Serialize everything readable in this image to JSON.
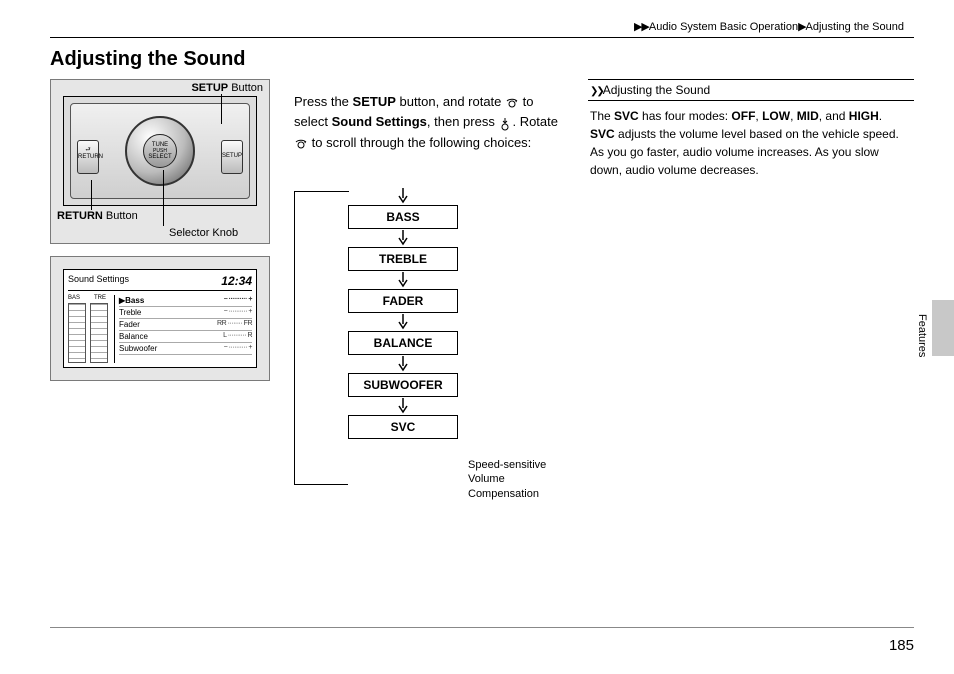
{
  "breadcrumb": {
    "chapter": "Audio System Basic Operation",
    "section": "Adjusting the Sound"
  },
  "title": "Adjusting the Sound",
  "labels": {
    "setup_button": "SETUP",
    "setup_suffix": " Button",
    "return_button": "RETURN",
    "return_suffix": " Button",
    "selector_knob": "Selector Knob",
    "knob_top": "TUNE",
    "knob_mid": "PUSH",
    "knob_bot": "SELECT",
    "btn_return_text": "RETURN",
    "btn_setup_text": "SETUP"
  },
  "screen": {
    "title": "Sound Settings",
    "time": "12:34",
    "eq_labels": [
      "BAS",
      "TRE"
    ],
    "rows": [
      {
        "name": "Bass",
        "scale": "− ·········· +"
      },
      {
        "name": "Treble",
        "scale": "− ·········· +"
      },
      {
        "name": "Fader",
        "scale": "RR ········ FR"
      },
      {
        "name": "Balance",
        "scale": "L ·········· R"
      },
      {
        "name": "Subwoofer",
        "scale": "− ·········· +"
      }
    ]
  },
  "instruction": {
    "p1a": "Press the ",
    "p1b": "SETUP",
    "p1c": " button, and rotate ",
    "p1d": " to select ",
    "p1e": "Sound Settings",
    "p1f": ", then press ",
    "p1g": ". Rotate ",
    "p1h": " to scroll through the following choices:"
  },
  "flow": {
    "items": [
      "BASS",
      "TREBLE",
      "FADER",
      "BALANCE",
      "SUBWOOFER",
      "SVC"
    ],
    "svc_caption": "Speed-sensitive Volume Compensation"
  },
  "note": {
    "header": "Adjusting the Sound",
    "line1a": "The ",
    "line1b": "SVC",
    "line1c": " has four modes: ",
    "m1": "OFF",
    "m2": "LOW",
    "m3": "MID",
    "m4": "HIGH",
    "line1d": ", and ",
    "line1e": ".",
    "line2a": "SVC",
    "line2b": " adjusts the volume level based on the vehicle speed. As you go faster, audio volume increases. As you slow down, audio volume decreases."
  },
  "side_tab": "Features",
  "page_number": "185"
}
